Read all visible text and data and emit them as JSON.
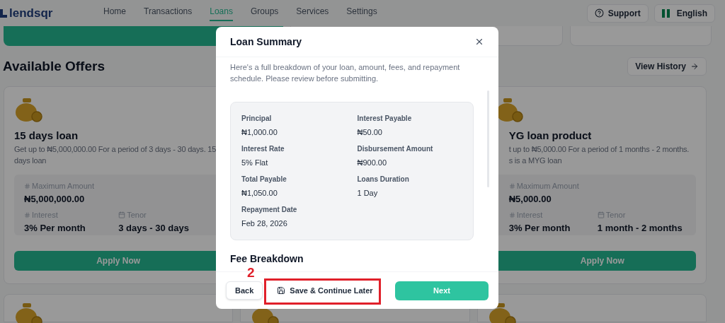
{
  "header": {
    "logo": "lendsqr",
    "nav": [
      {
        "label": "Home",
        "selected": false
      },
      {
        "label": "Transactions",
        "selected": false
      },
      {
        "label": "Loans",
        "selected": true
      },
      {
        "label": "Groups",
        "selected": false
      },
      {
        "label": "Services",
        "selected": false
      },
      {
        "label": "Settings",
        "selected": false
      }
    ],
    "support": "Support",
    "language": "English"
  },
  "offers": {
    "title": "Available Offers",
    "history_button": "View History",
    "cards": [
      {
        "title": "15 days loan",
        "description_lines": [
          "Get up to ₦5,000,000.00 For a period of 3 days - 30 days. 15",
          "days loan"
        ],
        "max_label": "Maximum Amount",
        "max_value": "₦5,000,000.00",
        "interest_label": "Interest",
        "interest_value": "3% Per month",
        "tenor_label": "Tenor",
        "tenor_value": "3 days - 30 days",
        "apply": "Apply Now"
      },
      {
        "title": "YG loan product",
        "description_lines": [
          "t up to ₦5,000.00 For a period of 1 months - 2 months.",
          "s is a MYG loan"
        ],
        "max_label": "Maximum Amount",
        "max_value": "₦5,000.00",
        "interest_label": "Interest",
        "interest_value": "3% Per month",
        "tenor_label": "Tenor",
        "tenor_value": "1 month - 2 months",
        "apply": "Apply Now"
      }
    ]
  },
  "modal": {
    "title": "Loan Summary",
    "description": "Here's a full breakdown of your loan, amount, fees, and repayment schedule. Please review before submitting.",
    "summary": [
      {
        "label": "Principal",
        "value": "₦1,000.00"
      },
      {
        "label": "Interest Payable",
        "value": "₦50.00"
      },
      {
        "label": "Interest Rate",
        "value": "5% Flat"
      },
      {
        "label": "Disbursement Amount",
        "value": "₦900.00"
      },
      {
        "label": "Total Payable",
        "value": "₦1,050.00"
      },
      {
        "label": "Loans Duration",
        "value": "1 Day"
      },
      {
        "label": "Repayment Date",
        "value": "Feb 28, 2026"
      }
    ],
    "fee_heading": "Fee Breakdown",
    "back": "Back",
    "save": "Save & Continue Later",
    "next": "Next"
  },
  "annotation": {
    "label": "2"
  }
}
